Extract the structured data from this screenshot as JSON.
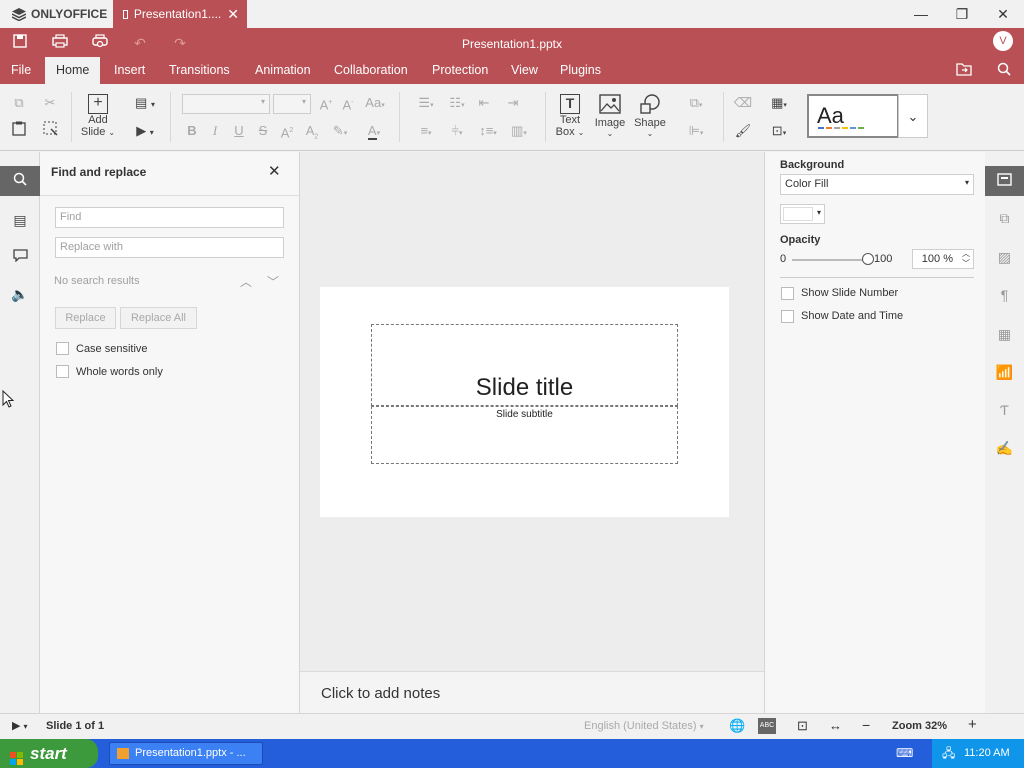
{
  "app": {
    "logo": "ONLYOFFICE",
    "tab_title": "Presentation1....",
    "doc_title": "Presentation1.pptx",
    "avatar": "V"
  },
  "window_controls": {
    "minimize": "—",
    "restore": "❐",
    "close": "✕"
  },
  "quick_access": {
    "save_icon": "save-icon",
    "print_icon": "print-icon",
    "quick_print_icon": "quick-print-icon",
    "undo_icon": "undo-icon",
    "redo_icon": "redo-icon"
  },
  "menu": {
    "tabs": [
      "File",
      "Home",
      "Insert",
      "Transitions",
      "Animation",
      "Collaboration",
      "Protection",
      "View",
      "Plugins"
    ],
    "active": "Home"
  },
  "toolbar": {
    "add_slide_line1": "Add",
    "add_slide_line2": "Slide",
    "text_box_line1": "Text",
    "text_box_line2": "Box",
    "image": "Image",
    "shape": "Shape",
    "theme_sample": "Aa"
  },
  "find_panel": {
    "title": "Find and replace",
    "find_placeholder": "Find",
    "replace_placeholder": "Replace with",
    "results": "No search results",
    "replace": "Replace",
    "replace_all": "Replace All",
    "case_sensitive": "Case sensitive",
    "whole_words": "Whole words only"
  },
  "slide": {
    "title": "Slide title",
    "subtitle": "Slide subtitle",
    "notes": "Click to add notes"
  },
  "right_panel": {
    "background_label": "Background",
    "fill_value": "Color Fill",
    "opacity_label": "Opacity",
    "opacity_min": "0",
    "opacity_max": "100",
    "opacity_value": "100 %",
    "opacity_level": 1.0,
    "show_slide_number": "Show Slide Number",
    "show_date_time": "Show Date and Time"
  },
  "status": {
    "slide_of": "Slide 1 of 1",
    "language": "English (United States)",
    "zoom": "Zoom 32%"
  },
  "taskbar": {
    "start": "start",
    "task": "Presentation1.pptx - ...",
    "time": "11:20 AM"
  },
  "colors": {
    "brand": "#b95055",
    "taskbar": "#245edb",
    "start": "#3c9a3c"
  }
}
